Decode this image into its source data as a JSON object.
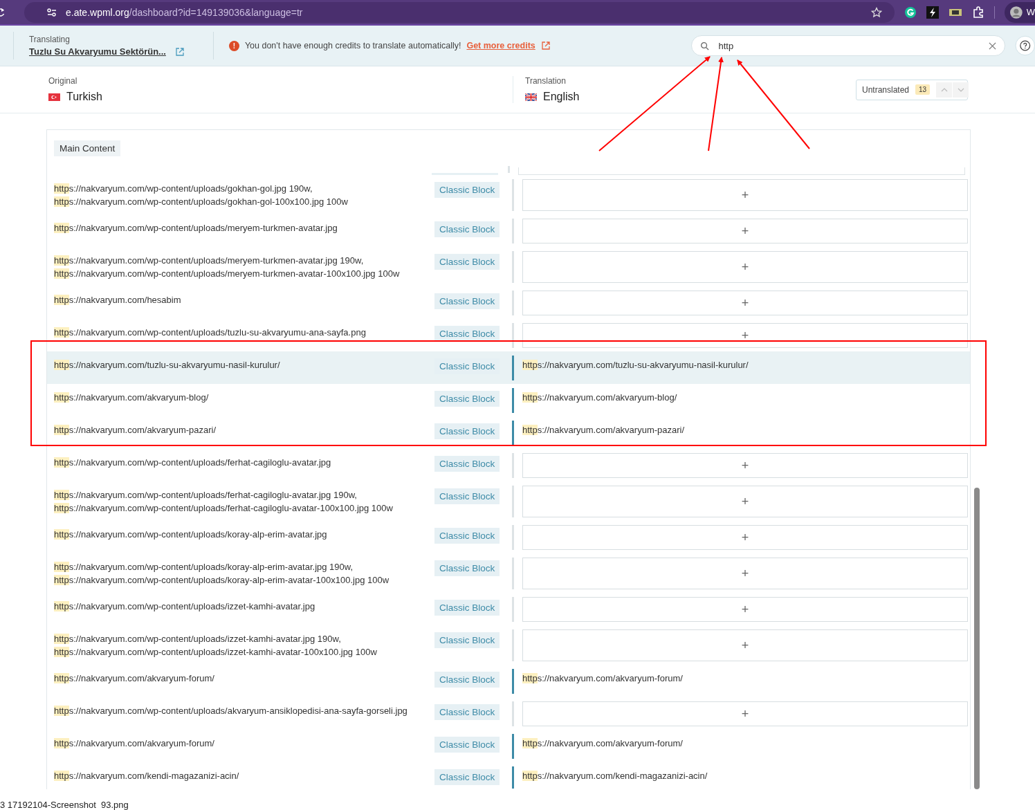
{
  "browser": {
    "url_host": "e.ate.wpml.org",
    "url_path": "/dashboard?id=149139036&language=tr",
    "profile_initial": "W"
  },
  "header": {
    "translating_label": "Translating",
    "document_title": "Tuzlu Su Akvaryumu Sektörün...",
    "alert_icon": "!",
    "alert_text": "You don't have enough credits to translate automatically!",
    "alert_link": "Get more credits",
    "search": {
      "value": "http"
    }
  },
  "languages": {
    "original_label": "Original",
    "original": "Turkish",
    "translation_label": "Translation",
    "translation": "English",
    "filter": {
      "label": "Untranslated",
      "count": "13"
    }
  },
  "section": {
    "title": "Main Content"
  },
  "rows": [
    {
      "source": [
        {
          "hit": "http",
          "rest": "s://nakvaryum.com/wp-content/uploads/gokhan-gol.jpg 190w,"
        },
        {
          "hit": "http",
          "rest": "s://nakvaryum.com/wp-content/uploads/gokhan-gol-100x100.jpg 100w"
        }
      ],
      "tag": "Classic Block",
      "selected": false,
      "translation": null
    },
    {
      "source": [
        {
          "hit": "http",
          "rest": "s://nakvaryum.com/wp-content/uploads/meryem-turkmen-avatar.jpg"
        }
      ],
      "tag": "Classic Block",
      "selected": false,
      "translation": null
    },
    {
      "source": [
        {
          "hit": "http",
          "rest": "s://nakvaryum.com/wp-content/uploads/meryem-turkmen-avatar.jpg 190w,"
        },
        {
          "hit": "http",
          "rest": "s://nakvaryum.com/wp-content/uploads/meryem-turkmen-avatar-100x100.jpg 100w"
        }
      ],
      "tag": "Classic Block",
      "selected": false,
      "translation": null
    },
    {
      "source": [
        {
          "hit": "http",
          "rest": "s://nakvaryum.com/hesabim"
        }
      ],
      "tag": "Classic Block",
      "selected": false,
      "translation": null
    },
    {
      "source": [
        {
          "hit": "http",
          "rest": "s://nakvaryum.com/wp-content/uploads/tuzlu-su-akvaryumu-ana-sayfa.png"
        }
      ],
      "tag": "Classic Block",
      "selected": false,
      "translation": null
    },
    {
      "source": [
        {
          "hit": "http",
          "rest": "s://nakvaryum.com/tuzlu-su-akvaryumu-nasil-kurulur/"
        }
      ],
      "tag": "Classic Block",
      "selected": true,
      "translation": {
        "hit": "http",
        "rest": "s://nakvaryum.com/tuzlu-su-akvaryumu-nasil-kurulur/"
      }
    },
    {
      "source": [
        {
          "hit": "http",
          "rest": "s://nakvaryum.com/akvaryum-blog/"
        }
      ],
      "tag": "Classic Block",
      "selected": false,
      "translation": {
        "hit": "http",
        "rest": "s://nakvaryum.com/akvaryum-blog/"
      }
    },
    {
      "source": [
        {
          "hit": "http",
          "rest": "s://nakvaryum.com/akvaryum-pazari/"
        }
      ],
      "tag": "Classic Block",
      "selected": false,
      "translation": {
        "hit": "http",
        "rest": "s://nakvaryum.com/akvaryum-pazari/"
      }
    },
    {
      "source": [
        {
          "hit": "http",
          "rest": "s://nakvaryum.com/wp-content/uploads/ferhat-cagiloglu-avatar.jpg"
        }
      ],
      "tag": "Classic Block",
      "selected": false,
      "translation": null
    },
    {
      "source": [
        {
          "hit": "http",
          "rest": "s://nakvaryum.com/wp-content/uploads/ferhat-cagiloglu-avatar.jpg 190w,"
        },
        {
          "hit": "http",
          "rest": "s://nakvaryum.com/wp-content/uploads/ferhat-cagiloglu-avatar-100x100.jpg 100w"
        }
      ],
      "tag": "Classic Block",
      "selected": false,
      "translation": null
    },
    {
      "source": [
        {
          "hit": "http",
          "rest": "s://nakvaryum.com/wp-content/uploads/koray-alp-erim-avatar.jpg"
        }
      ],
      "tag": "Classic Block",
      "selected": false,
      "translation": null
    },
    {
      "source": [
        {
          "hit": "http",
          "rest": "s://nakvaryum.com/wp-content/uploads/koray-alp-erim-avatar.jpg 190w,"
        },
        {
          "hit": "http",
          "rest": "s://nakvaryum.com/wp-content/uploads/koray-alp-erim-avatar-100x100.jpg 100w"
        }
      ],
      "tag": "Classic Block",
      "selected": false,
      "translation": null
    },
    {
      "source": [
        {
          "hit": "http",
          "rest": "s://nakvaryum.com/wp-content/uploads/izzet-kamhi-avatar.jpg"
        }
      ],
      "tag": "Classic Block",
      "selected": false,
      "translation": null
    },
    {
      "source": [
        {
          "hit": "http",
          "rest": "s://nakvaryum.com/wp-content/uploads/izzet-kamhi-avatar.jpg 190w,"
        },
        {
          "hit": "http",
          "rest": "s://nakvaryum.com/wp-content/uploads/izzet-kamhi-avatar-100x100.jpg 100w"
        }
      ],
      "tag": "Classic Block",
      "selected": false,
      "translation": null
    },
    {
      "source": [
        {
          "hit": "http",
          "rest": "s://nakvaryum.com/akvaryum-forum/"
        }
      ],
      "tag": "Classic Block",
      "selected": false,
      "translation": {
        "hit": "http",
        "rest": "s://nakvaryum.com/akvaryum-forum/"
      }
    },
    {
      "source": [
        {
          "hit": "http",
          "rest": "s://nakvaryum.com/wp-content/uploads/akvaryum-ansiklopedisi-ana-sayfa-gorseli.jpg"
        }
      ],
      "tag": "Classic Block",
      "selected": false,
      "translation": null
    },
    {
      "source": [
        {
          "hit": "http",
          "rest": "s://nakvaryum.com/akvaryum-forum/"
        }
      ],
      "tag": "Classic Block",
      "selected": false,
      "translation": {
        "hit": "http",
        "rest": "s://nakvaryum.com/akvaryum-forum/"
      }
    },
    {
      "source": [
        {
          "hit": "http",
          "rest": "s://nakvaryum.com/kendi-magazanizi-acin/"
        }
      ],
      "tag": "Classic Block",
      "selected": false,
      "translation": {
        "hit": "http",
        "rest": "s://nakvaryum.com/kendi-magazanizi-acin/"
      }
    }
  ],
  "add_symbol": "+",
  "caption": "3 17192104-Screenshot  93.png"
}
